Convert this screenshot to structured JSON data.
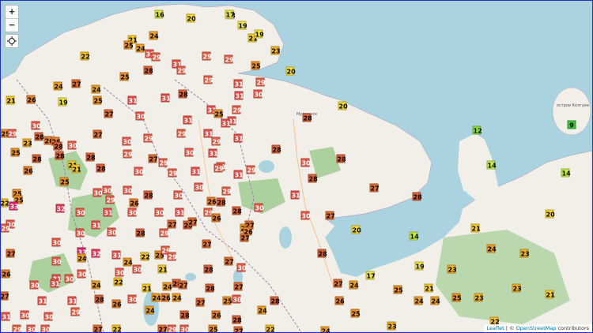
{
  "controls": {
    "zoom_in": "+",
    "zoom_out": "−"
  },
  "attribution": {
    "leaflet": "Leaflet",
    "sep": " | © ",
    "osm": "OpenStreetMap",
    "contrib": " contributors"
  },
  "places": {
    "murmansk": "Мурманск",
    "kolguyev": "остров Колгуев"
  },
  "colors": {
    "sea": "#aad3df",
    "land": "#f2efe9",
    "forest": "#add19e",
    "border": "#9c7fa8"
  },
  "temperatures": [
    [
      200,
      17,
      16
    ],
    [
      240,
      22,
      20
    ],
    [
      290,
      18,
      18
    ],
    [
      289,
      17,
      17
    ],
    [
      305,
      31,
      19
    ],
    [
      318,
      47,
      21
    ],
    [
      326,
      42,
      19
    ],
    [
      347,
      63,
      23
    ],
    [
      322,
      82,
      25
    ],
    [
      166,
      49,
      21
    ],
    [
      193,
      44,
      24
    ],
    [
      161,
      56,
      25
    ],
    [
      176,
      60,
      24
    ],
    [
      106,
      70,
      22
    ],
    [
      188,
      67,
      31
    ],
    [
      196,
      71,
      29
    ],
    [
      222,
      80,
      31
    ],
    [
      260,
      70,
      29
    ],
    [
      288,
      74,
      29
    ],
    [
      72,
      108,
      24
    ],
    [
      95,
      105,
      27
    ],
    [
      120,
      112,
      24
    ],
    [
      156,
      96,
      25
    ],
    [
      186,
      88,
      28
    ],
    [
      228,
      88,
      29
    ],
    [
      262,
      100,
      29
    ],
    [
      300,
      105,
      31
    ],
    [
      328,
      103,
      29
    ],
    [
      366,
      89,
      20
    ],
    [
      12,
      126,
      21
    ],
    [
      38,
      125,
      26
    ],
    [
      78,
      128,
      19
    ],
    [
      122,
      126,
      25
    ],
    [
      166,
      126,
      31
    ],
    [
      208,
      123,
      31
    ],
    [
      230,
      118,
      28
    ],
    [
      266,
      138,
      31
    ],
    [
      275,
      143,
      25
    ],
    [
      301,
      120,
      31
    ],
    [
      298,
      138,
      29
    ],
    [
      325,
      118,
      30
    ],
    [
      432,
      133,
      20
    ],
    [
      136,
      143,
      27
    ],
    [
      176,
      146,
      30
    ],
    [
      236,
      151,
      31
    ],
    [
      292,
      152,
      31
    ],
    [
      284,
      155,
      31
    ],
    [
      387,
      148,
      28
    ],
    [
      5,
      168,
      25
    ],
    [
      14,
      168,
      29
    ],
    [
      44,
      158,
      30
    ],
    [
      33,
      180,
      23
    ],
    [
      48,
      172,
      28
    ],
    [
      60,
      177,
      26
    ],
    [
      69,
      178,
      26
    ],
    [
      90,
      183,
      30
    ],
    [
      122,
      169,
      27
    ],
    [
      159,
      178,
      30
    ],
    [
      186,
      174,
      29
    ],
    [
      228,
      168,
      29
    ],
    [
      262,
      168,
      31
    ],
    [
      272,
      178,
      29
    ],
    [
      300,
      174,
      31
    ],
    [
      602,
      164,
      12
    ],
    [
      18,
      192,
      25
    ],
    [
      45,
      200,
      28
    ],
    [
      72,
      184,
      28
    ],
    [
      74,
      196,
      28
    ],
    [
      113,
      198,
      28
    ],
    [
      160,
      194,
      29
    ],
    [
      192,
      200,
      27
    ],
    [
      205,
      205,
      29
    ],
    [
      238,
      192,
      30
    ],
    [
      268,
      193,
      31
    ],
    [
      278,
      210,
      29
    ],
    [
      300,
      220,
      31
    ],
    [
      348,
      188,
      28
    ],
    [
      385,
      205,
      30
    ],
    [
      430,
      200,
      28
    ],
    [
      620,
      208,
      14
    ],
    [
      34,
      215,
      26
    ],
    [
      90,
      208,
      21
    ],
    [
      95,
      213,
      21
    ],
    [
      126,
      212,
      28
    ],
    [
      174,
      216,
      30
    ],
    [
      217,
      218,
      29
    ],
    [
      246,
      216,
      31
    ],
    [
      275,
      212,
      29
    ],
    [
      316,
      214,
      29
    ],
    [
      394,
      225,
      28
    ],
    [
      714,
      218,
      14
    ],
    [
      20,
      244,
      25
    ],
    [
      80,
      229,
      25
    ],
    [
      122,
      243,
      30
    ],
    [
      134,
      240,
      30
    ],
    [
      160,
      240,
      30
    ],
    [
      186,
      246,
      28
    ],
    [
      224,
      246,
      30
    ],
    [
      250,
      236,
      30
    ],
    [
      285,
      241,
      29
    ],
    [
      372,
      246,
      31
    ],
    [
      472,
      237,
      27
    ],
    [
      22,
      252,
      25
    ],
    [
      4,
      256,
      22
    ],
    [
      16,
      260,
      33
    ],
    [
      75,
      263,
      32
    ],
    [
      138,
      252,
      29
    ],
    [
      168,
      256,
      26
    ],
    [
      266,
      254,
      26
    ],
    [
      278,
      255,
      28
    ],
    [
      226,
      268,
      31
    ],
    [
      262,
      268,
      29
    ],
    [
      298,
      266,
      28
    ],
    [
      326,
      262,
      30
    ],
    [
      385,
      272,
      30
    ],
    [
      416,
      272,
      27
    ],
    [
      526,
      248,
      28
    ],
    [
      694,
      270,
      20
    ],
    [
      12,
      283,
      30
    ],
    [
      5,
      288,
      29
    ],
    [
      100,
      268,
      30
    ],
    [
      135,
      268,
      31
    ],
    [
      166,
      268,
      30
    ],
    [
      200,
      268,
      30
    ],
    [
      236,
      284,
      28
    ],
    [
      242,
      280,
      27
    ],
    [
      272,
      275,
      26
    ],
    [
      308,
      288,
      24
    ],
    [
      314,
      284,
      27
    ],
    [
      449,
      290,
      20
    ],
    [
      600,
      288,
      21
    ],
    [
      12,
      320,
      27
    ],
    [
      70,
      306,
      30
    ],
    [
      100,
      294,
      30
    ],
    [
      120,
      284,
      31
    ],
    [
      140,
      293,
      30
    ],
    [
      176,
      294,
      28
    ],
    [
      206,
      294,
      29
    ],
    [
      216,
      283,
      27
    ],
    [
      308,
      300,
      27
    ],
    [
      312,
      292,
      26
    ],
    [
      522,
      298,
      14
    ],
    [
      620,
      314,
      24
    ],
    [
      70,
      330,
      30
    ],
    [
      102,
      318,
      33
    ],
    [
      102,
      326,
      24
    ],
    [
      120,
      320,
      32
    ],
    [
      146,
      322,
      31
    ],
    [
      160,
      331,
      24
    ],
    [
      182,
      324,
      22
    ],
    [
      200,
      322,
      25
    ],
    [
      208,
      316,
      29
    ],
    [
      216,
      324,
      29
    ],
    [
      260,
      308,
      27
    ],
    [
      406,
      320,
      28
    ],
    [
      662,
      320,
      23
    ],
    [
      6,
      346,
      26
    ],
    [
      70,
      352,
      31
    ],
    [
      102,
      346,
      30
    ],
    [
      150,
      344,
      30
    ],
    [
      172,
      340,
      30
    ],
    [
      204,
      340,
      21
    ],
    [
      262,
      340,
      28
    ],
    [
      288,
      330,
      27
    ],
    [
      304,
      338,
      30
    ],
    [
      529,
      336,
      19
    ],
    [
      570,
      340,
      23
    ],
    [
      4,
      374,
      27
    ],
    [
      42,
      360,
      30
    ],
    [
      68,
      358,
      31
    ],
    [
      86,
      352,
      30
    ],
    [
      120,
      360,
      24
    ],
    [
      148,
      356,
      22
    ],
    [
      184,
      364,
      21
    ],
    [
      210,
      362,
      24
    ],
    [
      222,
      358,
      28
    ],
    [
      230,
      360,
      27
    ],
    [
      264,
      364,
      28
    ],
    [
      300,
      362,
      27
    ],
    [
      426,
      358,
      27
    ],
    [
      446,
      360,
      24
    ],
    [
      467,
      348,
      17
    ],
    [
      502,
      366,
      25
    ],
    [
      541,
      364,
      21
    ],
    [
      652,
      364,
      23
    ],
    [
      694,
      372,
      21
    ],
    [
      52,
      380,
      31
    ],
    [
      90,
      380,
      31
    ],
    [
      124,
      378,
      28
    ],
    [
      166,
      378,
      30
    ],
    [
      196,
      376,
      24
    ],
    [
      208,
      376,
      26
    ],
    [
      222,
      376,
      24
    ],
    [
      252,
      382,
      27
    ],
    [
      286,
      380,
      25
    ],
    [
      298,
      378,
      30
    ],
    [
      346,
      380,
      28
    ],
    [
      428,
      380,
      26
    ],
    [
      528,
      380,
      24
    ],
    [
      549,
      380,
      24
    ],
    [
      576,
      376,
      25
    ],
    [
      604,
      376,
      23
    ],
    [
      6,
      400,
      31
    ],
    [
      30,
      398,
      30
    ],
    [
      60,
      400,
      30
    ],
    [
      94,
      394,
      29
    ],
    [
      146,
      384,
      26
    ],
    [
      188,
      392,
      24
    ],
    [
      232,
      398,
      28
    ],
    [
      272,
      398,
      26
    ],
    [
      298,
      404,
      28
    ],
    [
      330,
      392,
      24
    ],
    [
      448,
      396,
      25
    ],
    [
      624,
      406,
      22
    ],
    [
      20,
      416,
      29
    ],
    [
      38,
      416,
      30
    ],
    [
      56,
      416,
      30
    ],
    [
      122,
      416,
      27
    ],
    [
      146,
      416,
      22
    ],
    [
      204,
      416,
      27
    ],
    [
      216,
      416,
      29
    ],
    [
      232,
      416,
      30
    ],
    [
      268,
      416,
      25
    ],
    [
      300,
      418,
      27
    ],
    [
      340,
      416,
      22
    ],
    [
      410,
      418,
      24
    ],
    [
      494,
      412,
      23
    ],
    [
      722,
      157,
      9
    ]
  ]
}
